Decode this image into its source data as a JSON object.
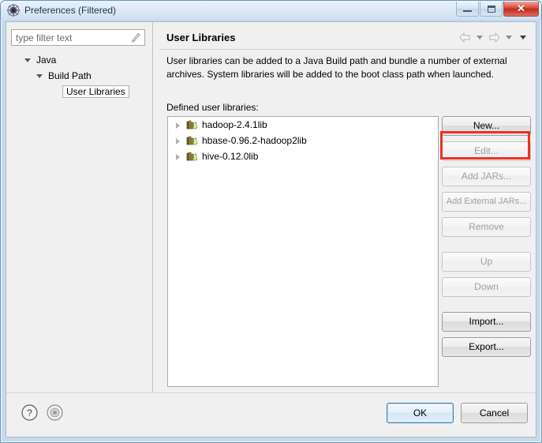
{
  "window": {
    "title": "Preferences (Filtered)",
    "icon": "preferences-gear-icon",
    "controls": {
      "minimize": "Minimize",
      "maximize": "Maximize",
      "close": "✕"
    }
  },
  "sidebar": {
    "filter": {
      "value": "",
      "placeholder": "type filter text",
      "icon": "clear-filter-icon"
    },
    "tree": [
      {
        "label": "Java",
        "level": 1,
        "expanded": true,
        "selected": false,
        "has_twisty": true
      },
      {
        "label": "Build Path",
        "level": 2,
        "expanded": true,
        "selected": false,
        "has_twisty": true
      },
      {
        "label": "User Libraries",
        "level": 3,
        "expanded": false,
        "selected": true,
        "has_twisty": false
      }
    ]
  },
  "main": {
    "title": "User Libraries",
    "nav": {
      "back_icon": "arrow-left-icon",
      "back_caret": "chevron-down-icon",
      "forward_icon": "arrow-right-icon",
      "forward_caret": "chevron-down-icon",
      "menu_caret": "chevron-down-icon"
    },
    "description": "User libraries can be added to a Java Build path and bundle a number of external archives. System libraries will be added to the boot class path when launched.",
    "list_label": "Defined user libraries:",
    "libraries": [
      {
        "name": "hadoop-2.4.1lib",
        "icon": "library-icon",
        "expandable": true
      },
      {
        "name": "hbase-0.96.2-hadoop2lib",
        "icon": "library-icon",
        "expandable": true
      },
      {
        "name": "hive-0.12.0lib",
        "icon": "library-icon",
        "expandable": true
      }
    ],
    "buttons": [
      {
        "label": "New...",
        "enabled": true,
        "highlighted": true
      },
      {
        "label": "Edit...",
        "enabled": false,
        "highlighted": false
      },
      {
        "label": "Add JARs...",
        "enabled": false,
        "highlighted": false
      },
      {
        "label": "Add External JARs...",
        "enabled": false,
        "highlighted": false
      },
      {
        "label": "Remove",
        "enabled": false,
        "highlighted": false
      },
      {
        "label": "Up",
        "enabled": false,
        "highlighted": false
      },
      {
        "label": "Down",
        "enabled": false,
        "highlighted": false
      },
      {
        "label": "Import...",
        "enabled": true,
        "highlighted": false
      },
      {
        "label": "Export...",
        "enabled": true,
        "highlighted": false
      }
    ]
  },
  "footer": {
    "help_icon": "question-mark-icon",
    "info_icon": "circle-info-icon",
    "ok_label": "OK",
    "cancel_label": "Cancel"
  },
  "colors": {
    "annotation": "#ee3124",
    "title_bar": "#dbe8f5",
    "close_button": "#d9473a",
    "default_button_border": "#3c7fb1"
  }
}
